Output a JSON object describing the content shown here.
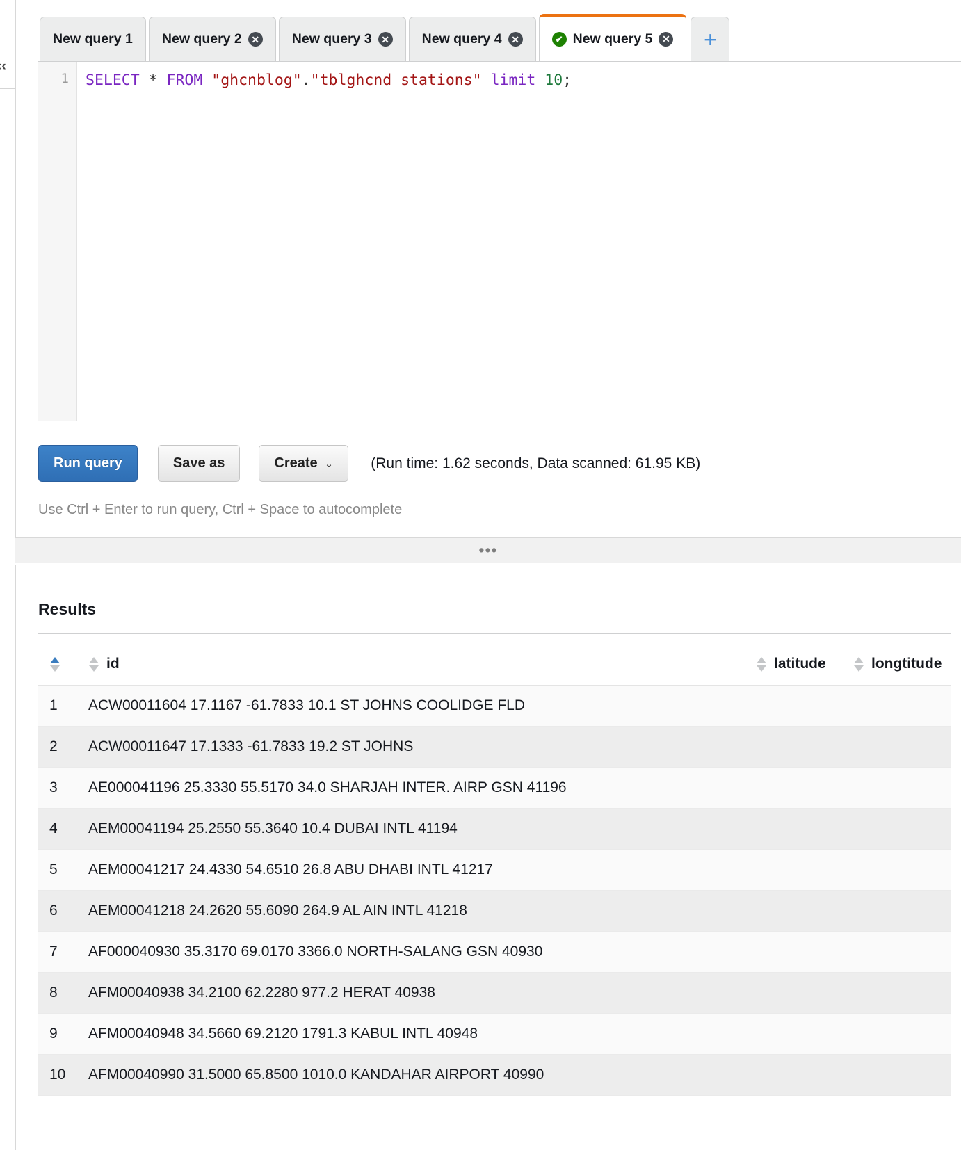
{
  "tabs": {
    "items": [
      {
        "label": "New query 1",
        "closable": false,
        "active": false,
        "status": ""
      },
      {
        "label": "New query 2",
        "closable": true,
        "active": false,
        "status": ""
      },
      {
        "label": "New query 3",
        "closable": true,
        "active": false,
        "status": ""
      },
      {
        "label": "New query 4",
        "closable": true,
        "active": false,
        "status": ""
      },
      {
        "label": "New query 5",
        "closable": true,
        "active": true,
        "status": "success"
      }
    ],
    "add_label": "+",
    "close_glyph": "✕",
    "status_glyph": "✔",
    "active_accent_color": "#ec7211",
    "status_color": "#1d8102"
  },
  "editor": {
    "line_number": "1",
    "query_tokens": [
      {
        "text": "SELECT",
        "type": "keyword"
      },
      {
        "text": " * ",
        "type": "punct"
      },
      {
        "text": "FROM",
        "type": "keyword"
      },
      {
        "text": " ",
        "type": "punct"
      },
      {
        "text": "\"ghcnblog\"",
        "type": "string"
      },
      {
        "text": ".",
        "type": "punct"
      },
      {
        "text": "\"tblghcnd_stations\"",
        "type": "string"
      },
      {
        "text": " ",
        "type": "punct"
      },
      {
        "text": "limit",
        "type": "keyword"
      },
      {
        "text": " ",
        "type": "punct"
      },
      {
        "text": "10",
        "type": "number"
      },
      {
        "text": ";",
        "type": "punct"
      }
    ],
    "query_plain": "SELECT * FROM \"ghcnblog\".\"tblghcnd_stations\" limit 10;"
  },
  "toolbar": {
    "run_label": "Run query",
    "save_label": "Save as",
    "create_label": "Create",
    "create_caret": "⌄",
    "run_stats": "(Run time: 1.62 seconds, Data scanned: 61.95 KB)",
    "hint": "Use Ctrl + Enter to run query, Ctrl + Space to autocomplete",
    "primary_color": "#2f6fb5"
  },
  "splitter": {
    "handle": "•••"
  },
  "results": {
    "title": "Results",
    "columns": [
      {
        "key": "num",
        "label": "",
        "sorted": true
      },
      {
        "key": "id",
        "label": "id",
        "sorted": false
      },
      {
        "key": "latitude",
        "label": "latitude",
        "sorted": false
      },
      {
        "key": "longtitude",
        "label": "longtitude",
        "sorted": false
      }
    ],
    "rows": [
      {
        "num": "1",
        "id": "ACW00011604 17.1167 -61.7833 10.1 ST JOHNS COOLIDGE FLD",
        "latitude": "",
        "longtitude": ""
      },
      {
        "num": "2",
        "id": "ACW00011647 17.1333 -61.7833 19.2 ST JOHNS",
        "latitude": "",
        "longtitude": ""
      },
      {
        "num": "3",
        "id": "AE000041196 25.3330 55.5170 34.0 SHARJAH INTER. AIRP GSN 41196",
        "latitude": "",
        "longtitude": ""
      },
      {
        "num": "4",
        "id": "AEM00041194 25.2550 55.3640 10.4 DUBAI INTL 41194",
        "latitude": "",
        "longtitude": ""
      },
      {
        "num": "5",
        "id": "AEM00041217 24.4330 54.6510 26.8 ABU DHABI INTL 41217",
        "latitude": "",
        "longtitude": ""
      },
      {
        "num": "6",
        "id": "AEM00041218 24.2620 55.6090 264.9 AL AIN INTL 41218",
        "latitude": "",
        "longtitude": ""
      },
      {
        "num": "7",
        "id": "AF000040930 35.3170 69.0170 3366.0 NORTH-SALANG GSN 40930",
        "latitude": "",
        "longtitude": ""
      },
      {
        "num": "8",
        "id": "AFM00040938 34.2100 62.2280 977.2 HERAT 40938",
        "latitude": "",
        "longtitude": ""
      },
      {
        "num": "9",
        "id": "AFM00040948 34.5660 69.2120 1791.3 KABUL INTL 40948",
        "latitude": "",
        "longtitude": ""
      },
      {
        "num": "10",
        "id": "AFM00040990 31.5000 65.8500 1010.0 KANDAHAR AIRPORT 40990",
        "latitude": "",
        "longtitude": ""
      }
    ]
  }
}
